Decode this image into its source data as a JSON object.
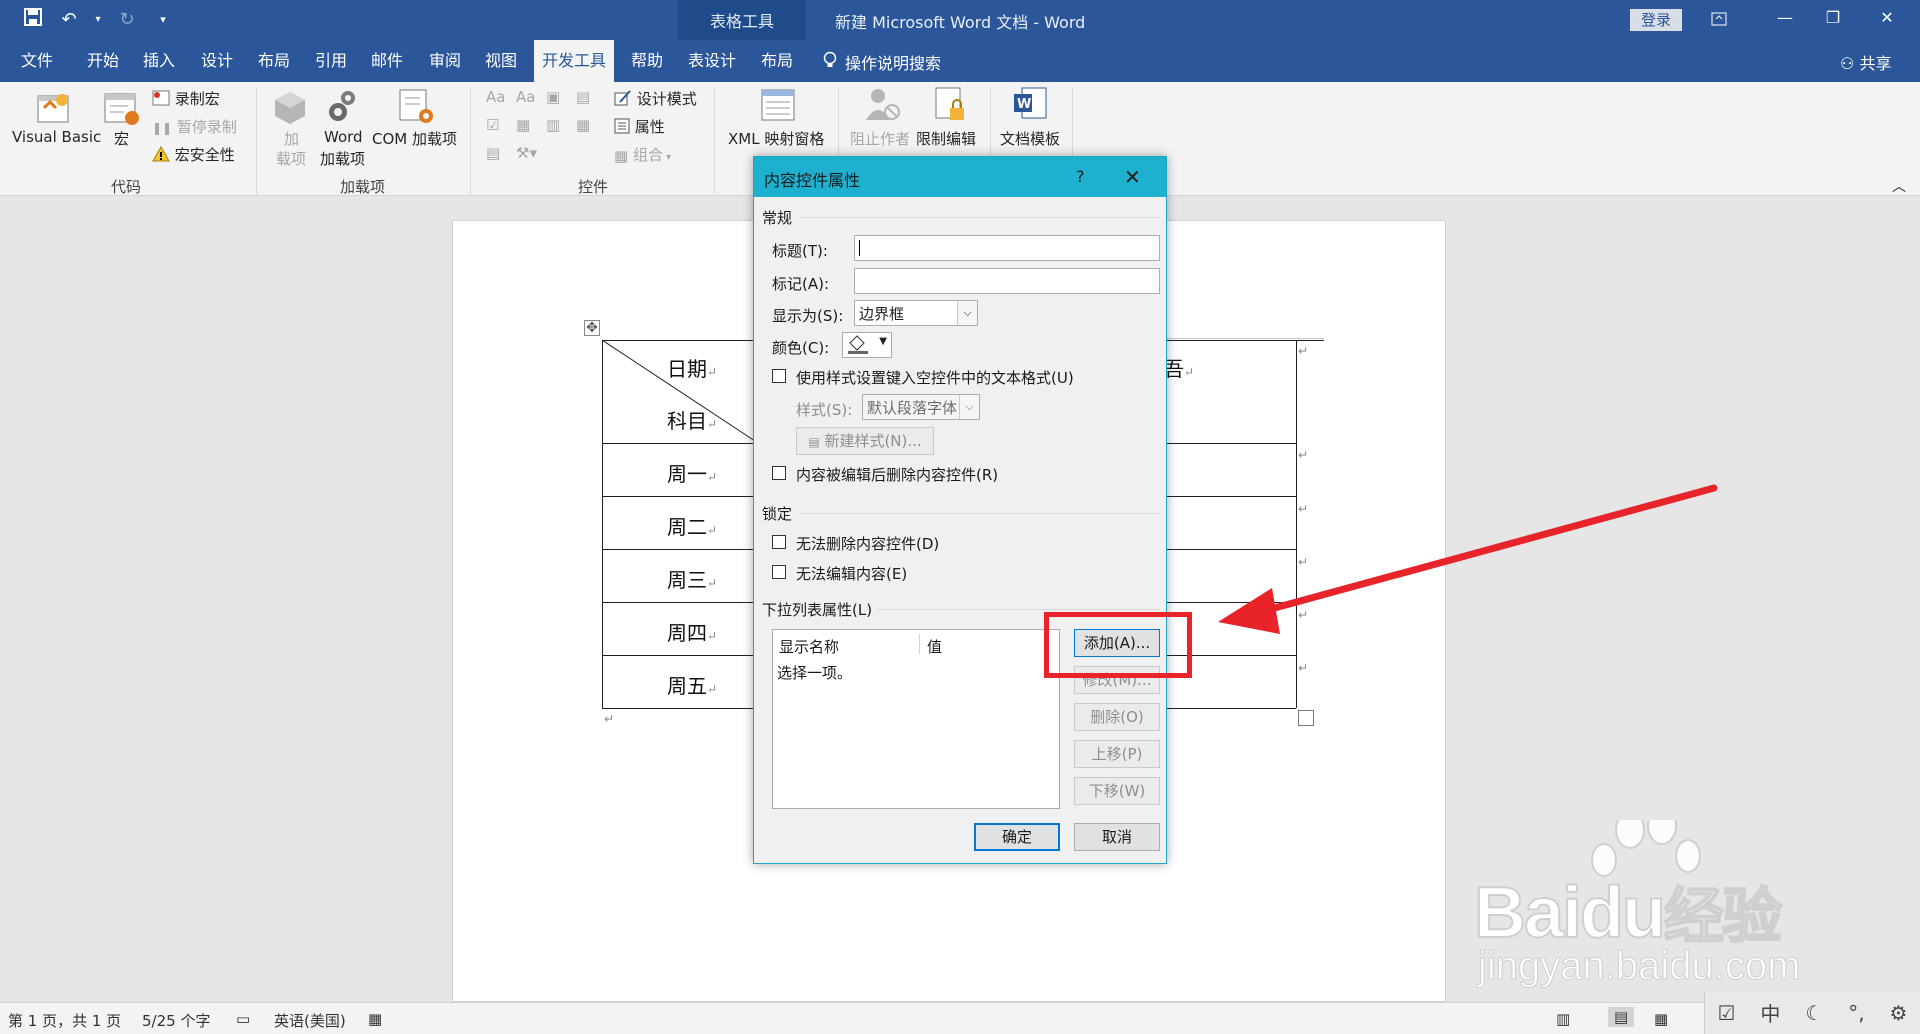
{
  "titlebar": {
    "context_tools": "表格工具",
    "doc_title": "新建 Microsoft Word 文档  -  Word",
    "login": "登录"
  },
  "tabs": [
    "文件",
    "开始",
    "插入",
    "设计",
    "布局",
    "引用",
    "邮件",
    "审阅",
    "视图",
    "开发工具",
    "帮助",
    "表设计",
    "布局"
  ],
  "tab_search": "操作说明搜索",
  "tab_share": "共享",
  "ribbon": {
    "code": {
      "visual_basic": "Visual Basic",
      "macros": "宏",
      "record_macro": "录制宏",
      "pause_recording": "暂停录制",
      "macro_security": "宏安全性",
      "label": "代码"
    },
    "addins": {
      "addin_line1": "加",
      "addin_line2": "载项",
      "word_line1": "Word",
      "word_line2": "加载项",
      "com": "COM 加载项",
      "label": "加载项"
    },
    "controls": {
      "design_mode": "设计模式",
      "properties": "属性",
      "group": "组合",
      "label": "控件"
    },
    "mapping": {
      "xml_pane": "XML 映射窗格"
    },
    "protect": {
      "block_authors": "阻止作者",
      "restrict_editing": "限制编辑"
    },
    "templates": {
      "doc_template": "文档模板"
    }
  },
  "table": {
    "header_date": "日期",
    "header_subject": "科目",
    "header_partial": "吾",
    "rows": [
      "周一",
      "周二",
      "周三",
      "周四",
      "周五"
    ]
  },
  "statusbar": {
    "page": "第 1 页，共 1 页",
    "words": "5/25 个字",
    "language": "英语(美国)"
  },
  "tray": {
    "ime": "中"
  },
  "dialog": {
    "title": "内容控件属性",
    "help": "?",
    "general": "常规",
    "title_label": "标题(T):",
    "tag_label": "标记(A):",
    "show_as_label": "显示为(S):",
    "show_as_value": "边界框",
    "color_label": "颜色(C):",
    "use_style": "使用样式设置键入空控件中的文本格式(U)",
    "style_label": "样式(S):",
    "style_value": "默认段落字体",
    "new_style": "新建样式(N)...",
    "remove_when_edited": "内容被编辑后删除内容控件(R)",
    "locking": "锁定",
    "cannot_delete": "无法删除内容控件(D)",
    "cannot_edit": "无法编辑内容(E)",
    "dropdown_props": "下拉列表属性(L)",
    "col_display": "显示名称",
    "col_value": "值",
    "item_placeholder": "选择一项。",
    "btn_add": "添加(A)...",
    "btn_modify": "修改(M)...",
    "btn_remove": "删除(O)",
    "btn_up": "上移(P)",
    "btn_down": "下移(W)",
    "btn_ok": "确定",
    "btn_cancel": "取消"
  },
  "watermark": {
    "brand": "Bai",
    "brand2": "du",
    "brand_cn": "经验",
    "url": "jingyan.baidu.com"
  },
  "colors": {
    "word_blue": "#2b579a",
    "dialog_title": "#1db0cf",
    "annotation_red": "#e8232a"
  }
}
